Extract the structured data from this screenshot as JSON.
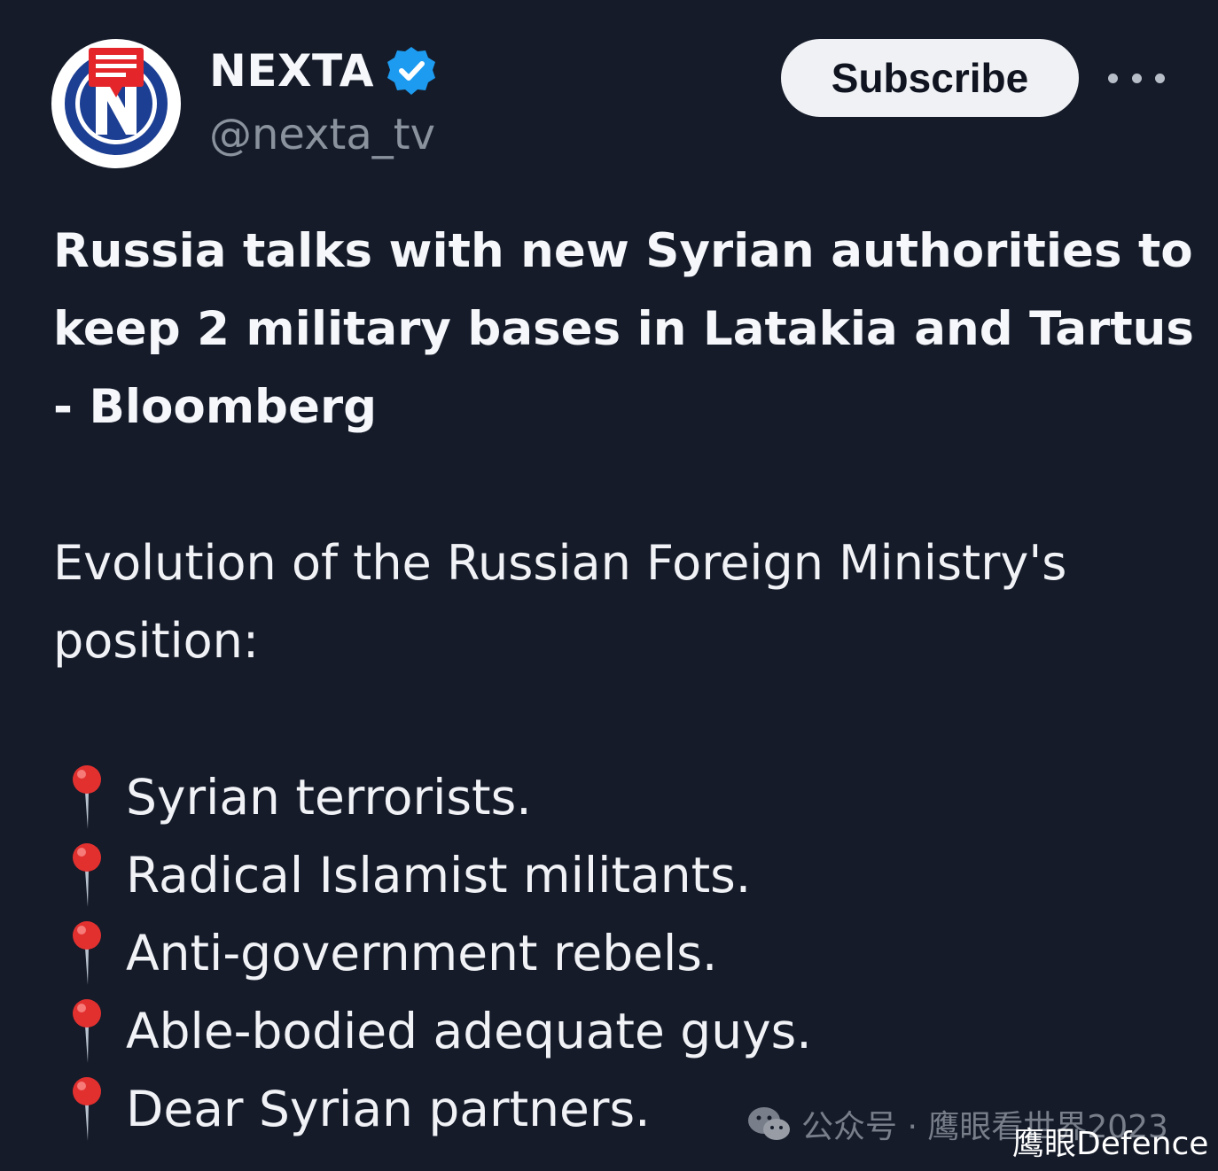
{
  "author": {
    "display_name": "NEXTA",
    "handle": "@nexta_tv",
    "verified": true,
    "avatar_icon": "nexta-logo",
    "verified_badge_color": "#1d9bf0"
  },
  "actions": {
    "subscribe_label": "Subscribe",
    "more_icon": "more-dots-icon"
  },
  "post": {
    "headline_lines": [
      "Russia talks with new Syrian authorities to",
      "keep 2 military bases in Latakia and Tartus",
      "- Bloomberg"
    ],
    "intro_lines": [
      "Evolution of the Russian Foreign Ministry's",
      "position:"
    ],
    "list_icon": "round-pushpin-icon",
    "list": [
      "Syrian terrorists.",
      "Radical Islamist militants.",
      "Anti-government rebels.",
      "Able-bodied adequate guys.",
      "Dear Syrian partners."
    ]
  },
  "watermark": {
    "text": "公众号 · 鹰眼看世界2023",
    "brand": "鹰眼Defence",
    "icon": "wechat-icon"
  },
  "colors": {
    "background": "#151b29",
    "text": "#f5f7fa",
    "secondary_text": "#8a929e",
    "button_bg": "#eff1f4"
  }
}
